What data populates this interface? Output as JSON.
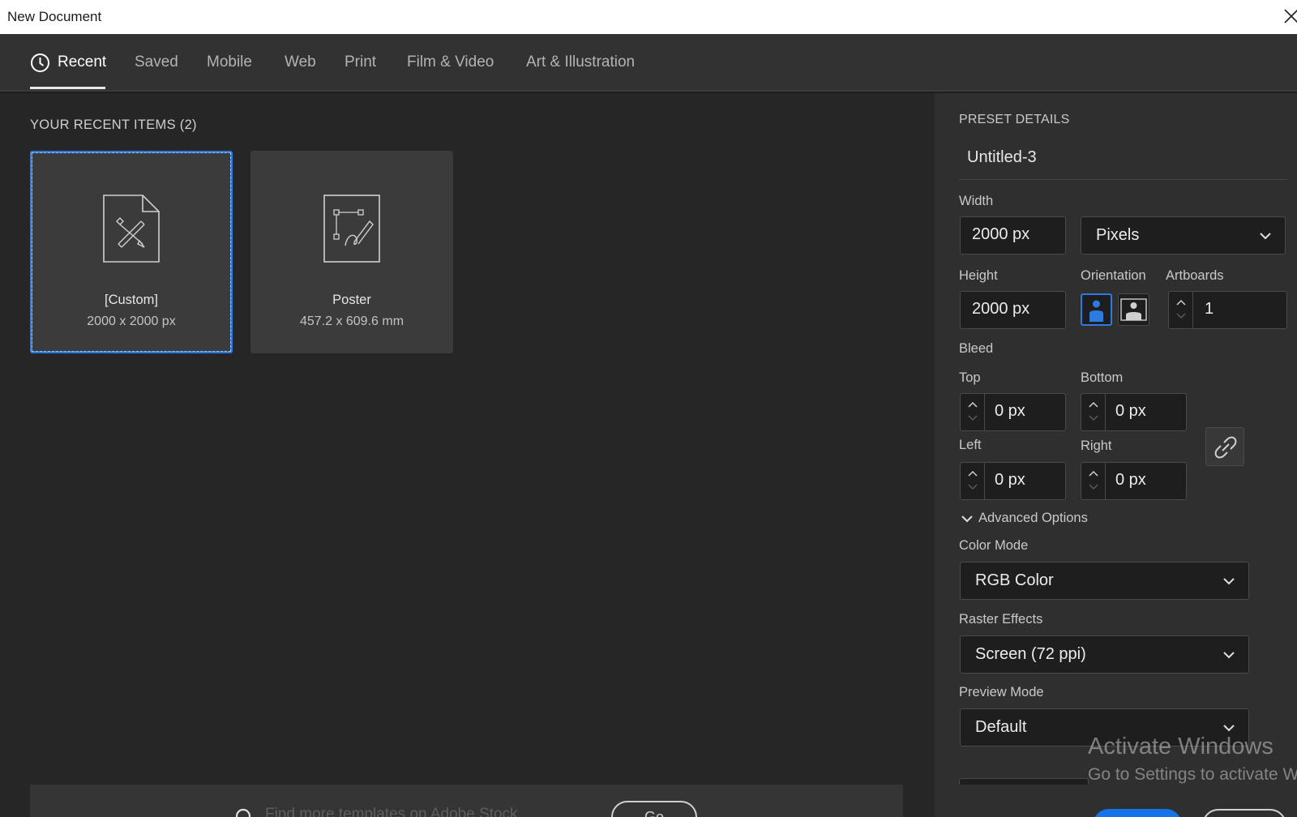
{
  "window": {
    "title": "New Document"
  },
  "tabs": [
    {
      "label": "Recent"
    },
    {
      "label": "Saved"
    },
    {
      "label": "Mobile"
    },
    {
      "label": "Web"
    },
    {
      "label": "Print"
    },
    {
      "label": "Film & Video"
    },
    {
      "label": "Art & Illustration"
    }
  ],
  "recent": {
    "heading": "YOUR RECENT ITEMS  (2)",
    "items": [
      {
        "name": "[Custom]",
        "size": "2000 x 2000 px",
        "selected": true
      },
      {
        "name": "Poster",
        "size": "457.2 x 609.6 mm",
        "selected": false
      }
    ]
  },
  "search": {
    "placeholder": "Find more templates on Adobe Stock",
    "go_label": "Go"
  },
  "preset": {
    "heading": "PRESET DETAILS",
    "doc_name": "Untitled-3",
    "width_label": "Width",
    "width_value": "2000 px",
    "units_value": "Pixels",
    "height_label": "Height",
    "height_value": "2000 px",
    "orientation_label": "Orientation",
    "artboards_label": "Artboards",
    "artboards_value": "1",
    "bleed_label": "Bleed",
    "top_label": "Top",
    "top_value": "0 px",
    "bottom_label": "Bottom",
    "bottom_value": "0 px",
    "left_label": "Left",
    "left_value": "0 px",
    "right_label": "Right",
    "right_value": "0 px",
    "advanced_label": "Advanced Options",
    "color_mode_label": "Color Mode",
    "color_mode_value": "RGB Color",
    "raster_label": "Raster Effects",
    "raster_value": "Screen (72 ppi)",
    "preview_label": "Preview Mode",
    "preview_value": "Default"
  },
  "watermark": {
    "line1": "Activate Windows",
    "line2": "Go to Settings to activate Windows."
  },
  "colors": {
    "accent": "#1473e6",
    "selection": "#2d7be0",
    "panel_bg": "#2f2f2f",
    "left_bg": "#262626"
  }
}
